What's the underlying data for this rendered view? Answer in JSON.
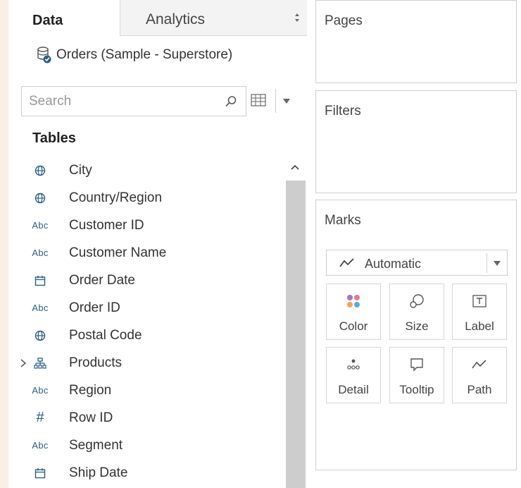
{
  "tabs": {
    "data_label": "Data",
    "analytics_label": "Analytics"
  },
  "datasource": {
    "name": "Orders (Sample - Superstore)"
  },
  "search": {
    "placeholder": "Search"
  },
  "tables": {
    "heading": "Tables",
    "fields": [
      {
        "label": "City",
        "type": "geo",
        "icon": "globe-icon"
      },
      {
        "label": "Country/Region",
        "type": "geo",
        "icon": "globe-icon"
      },
      {
        "label": "Customer ID",
        "type": "string",
        "icon_text": "Abc"
      },
      {
        "label": "Customer Name",
        "type": "string",
        "icon_text": "Abc"
      },
      {
        "label": "Order Date",
        "type": "date",
        "icon": "calendar-icon"
      },
      {
        "label": "Order ID",
        "type": "string",
        "icon_text": "Abc"
      },
      {
        "label": "Postal Code",
        "type": "geo",
        "icon": "globe-icon"
      },
      {
        "label": "Products",
        "type": "hierarchy",
        "icon": "hierarchy-icon",
        "expander": "chevron-right-icon"
      },
      {
        "label": "Region",
        "type": "string",
        "icon_text": "Abc"
      },
      {
        "label": "Row ID",
        "type": "number",
        "icon_text": "#"
      },
      {
        "label": "Segment",
        "type": "string",
        "icon_text": "Abc"
      },
      {
        "label": "Ship Date",
        "type": "date",
        "icon": "calendar-icon"
      }
    ]
  },
  "shelves": {
    "pages_title": "Pages",
    "filters_title": "Filters",
    "marks_title": "Marks"
  },
  "marks": {
    "type_label": "Automatic",
    "type_icon": "line-chart-icon",
    "buttons": [
      {
        "label": "Color",
        "icon": "color-dots-icon"
      },
      {
        "label": "Size",
        "icon": "size-icon"
      },
      {
        "label": "Label",
        "icon": "label-t-icon"
      },
      {
        "label": "Detail",
        "icon": "detail-dots-icon"
      },
      {
        "label": "Tooltip",
        "icon": "tooltip-icon"
      },
      {
        "label": "Path",
        "icon": "path-icon"
      }
    ]
  },
  "colors": {
    "page_background": "#fbeee6",
    "icon_blue": "#2b5f86",
    "color_dot_purple": "#a678b6",
    "color_dot_pink": "#e47a8f",
    "color_dot_orange": "#f0a35a",
    "color_dot_blue": "#5ea8d8",
    "scroll_thumb": "#cdcdcd"
  }
}
